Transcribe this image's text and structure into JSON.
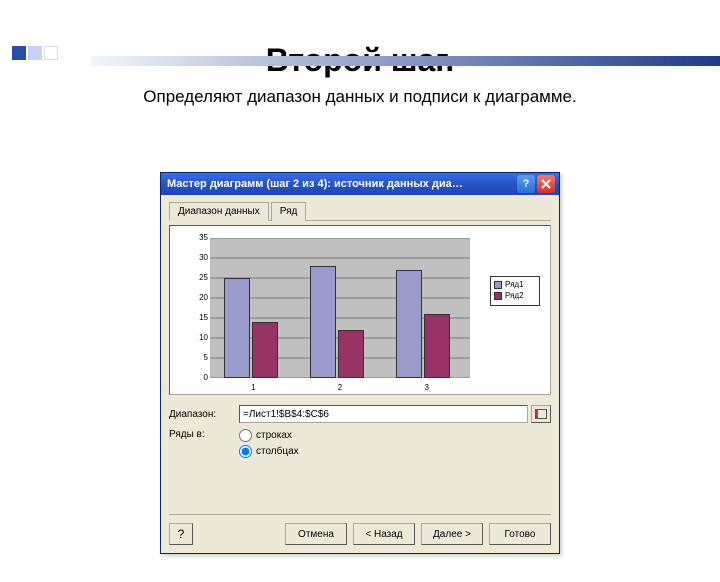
{
  "slide": {
    "title": "Второй шаг.",
    "subtitle": "Определяют диапазон данных и подписи к диаграмме."
  },
  "dialog": {
    "title": "Мастер диаграмм (шаг 2 из 4): источник данных диа…",
    "tabs": {
      "data_range": "Диапазон данных",
      "series": "Ряд"
    },
    "range_label": "Диапазон:",
    "range_value": "=Лист1!$B$4:$C$6",
    "rows_in_label": "Ряды в:",
    "radio_rows": "строках",
    "radio_cols": "столбцах",
    "buttons": {
      "cancel": "Отмена",
      "back": "< Назад",
      "next": "Далее >",
      "finish": "Готово"
    },
    "help_glyph": "?"
  },
  "legend": {
    "series1": "Ряд1",
    "series2": "Ряд2"
  },
  "chart_data": {
    "type": "bar",
    "categories": [
      "1",
      "2",
      "3"
    ],
    "series": [
      {
        "name": "Ряд1",
        "values": [
          25,
          28,
          27
        ],
        "color": "#9999cc"
      },
      {
        "name": "Ряд2",
        "values": [
          14,
          12,
          16
        ],
        "color": "#993366"
      }
    ],
    "ylim": [
      0,
      35
    ],
    "yticks": [
      0,
      5,
      10,
      15,
      20,
      25,
      30,
      35
    ],
    "xlabel": "",
    "ylabel": "",
    "title": ""
  }
}
